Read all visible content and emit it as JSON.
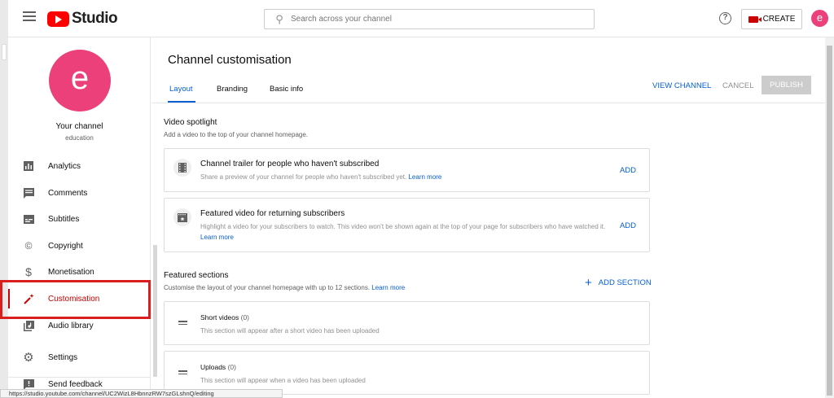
{
  "header": {
    "logo_text": "Studio",
    "search_placeholder": "Search across your channel",
    "create_label": "CREATE",
    "avatar_letter": "e"
  },
  "sidebar": {
    "avatar_letter": "e",
    "channel_label": "Your channel",
    "channel_name": "education",
    "items": [
      {
        "label": "Analytics",
        "icon": "analytics-icon"
      },
      {
        "label": "Comments",
        "icon": "comments-icon"
      },
      {
        "label": "Subtitles",
        "icon": "subtitles-icon"
      },
      {
        "label": "Copyright",
        "icon": "copyright-icon"
      },
      {
        "label": "Monetisation",
        "icon": "dollar-icon"
      },
      {
        "label": "Customisation",
        "icon": "magic-wand-icon",
        "active": true
      },
      {
        "label": "Audio library",
        "icon": "audio-library-icon"
      },
      {
        "label": "Settings",
        "icon": "gear-icon"
      },
      {
        "label": "Send feedback",
        "icon": "feedback-icon"
      }
    ]
  },
  "main": {
    "title": "Channel customisation",
    "tabs": [
      {
        "label": "Layout",
        "active": true
      },
      {
        "label": "Branding"
      },
      {
        "label": "Basic info"
      }
    ],
    "actions": {
      "view_channel": "VIEW CHANNEL",
      "cancel": "CANCEL",
      "publish": "PUBLISH"
    },
    "video_spotlight": {
      "title": "Video spotlight",
      "subtitle": "Add a video to the top of your channel homepage.",
      "cards": [
        {
          "title": "Channel trailer for people who haven't subscribed",
          "desc": "Share a preview of your channel for people who haven't subscribed yet.",
          "link": "Learn more",
          "action": "ADD"
        },
        {
          "title": "Featured video for returning subscribers",
          "desc": "Highlight a video for your subscribers to watch. This video won't be shown again at the top of your page for subscribers who have watched it.",
          "link": "Learn more",
          "action": "ADD"
        }
      ]
    },
    "featured_sections": {
      "title": "Featured sections",
      "subtitle": "Customise the layout of your channel homepage with up to 12 sections.",
      "link": "Learn more",
      "add_section": "ADD SECTION",
      "sections": [
        {
          "title": "Short videos",
          "count": "(0)",
          "desc": "This section will appear after a short video has been uploaded"
        },
        {
          "title": "Uploads",
          "count": "(0)",
          "desc": "This section will appear when a video has been uploaded"
        }
      ]
    }
  },
  "statusbar": {
    "url": "https://studio.youtube.com/channel/UC2WizL8HbnnzRW7szGLshnQ/editing"
  },
  "colors": {
    "accent_blue": "#065fd4",
    "brand_red": "#ff0000",
    "avatar_pink": "#ec407a",
    "highlight_red": "#d91e1e"
  }
}
